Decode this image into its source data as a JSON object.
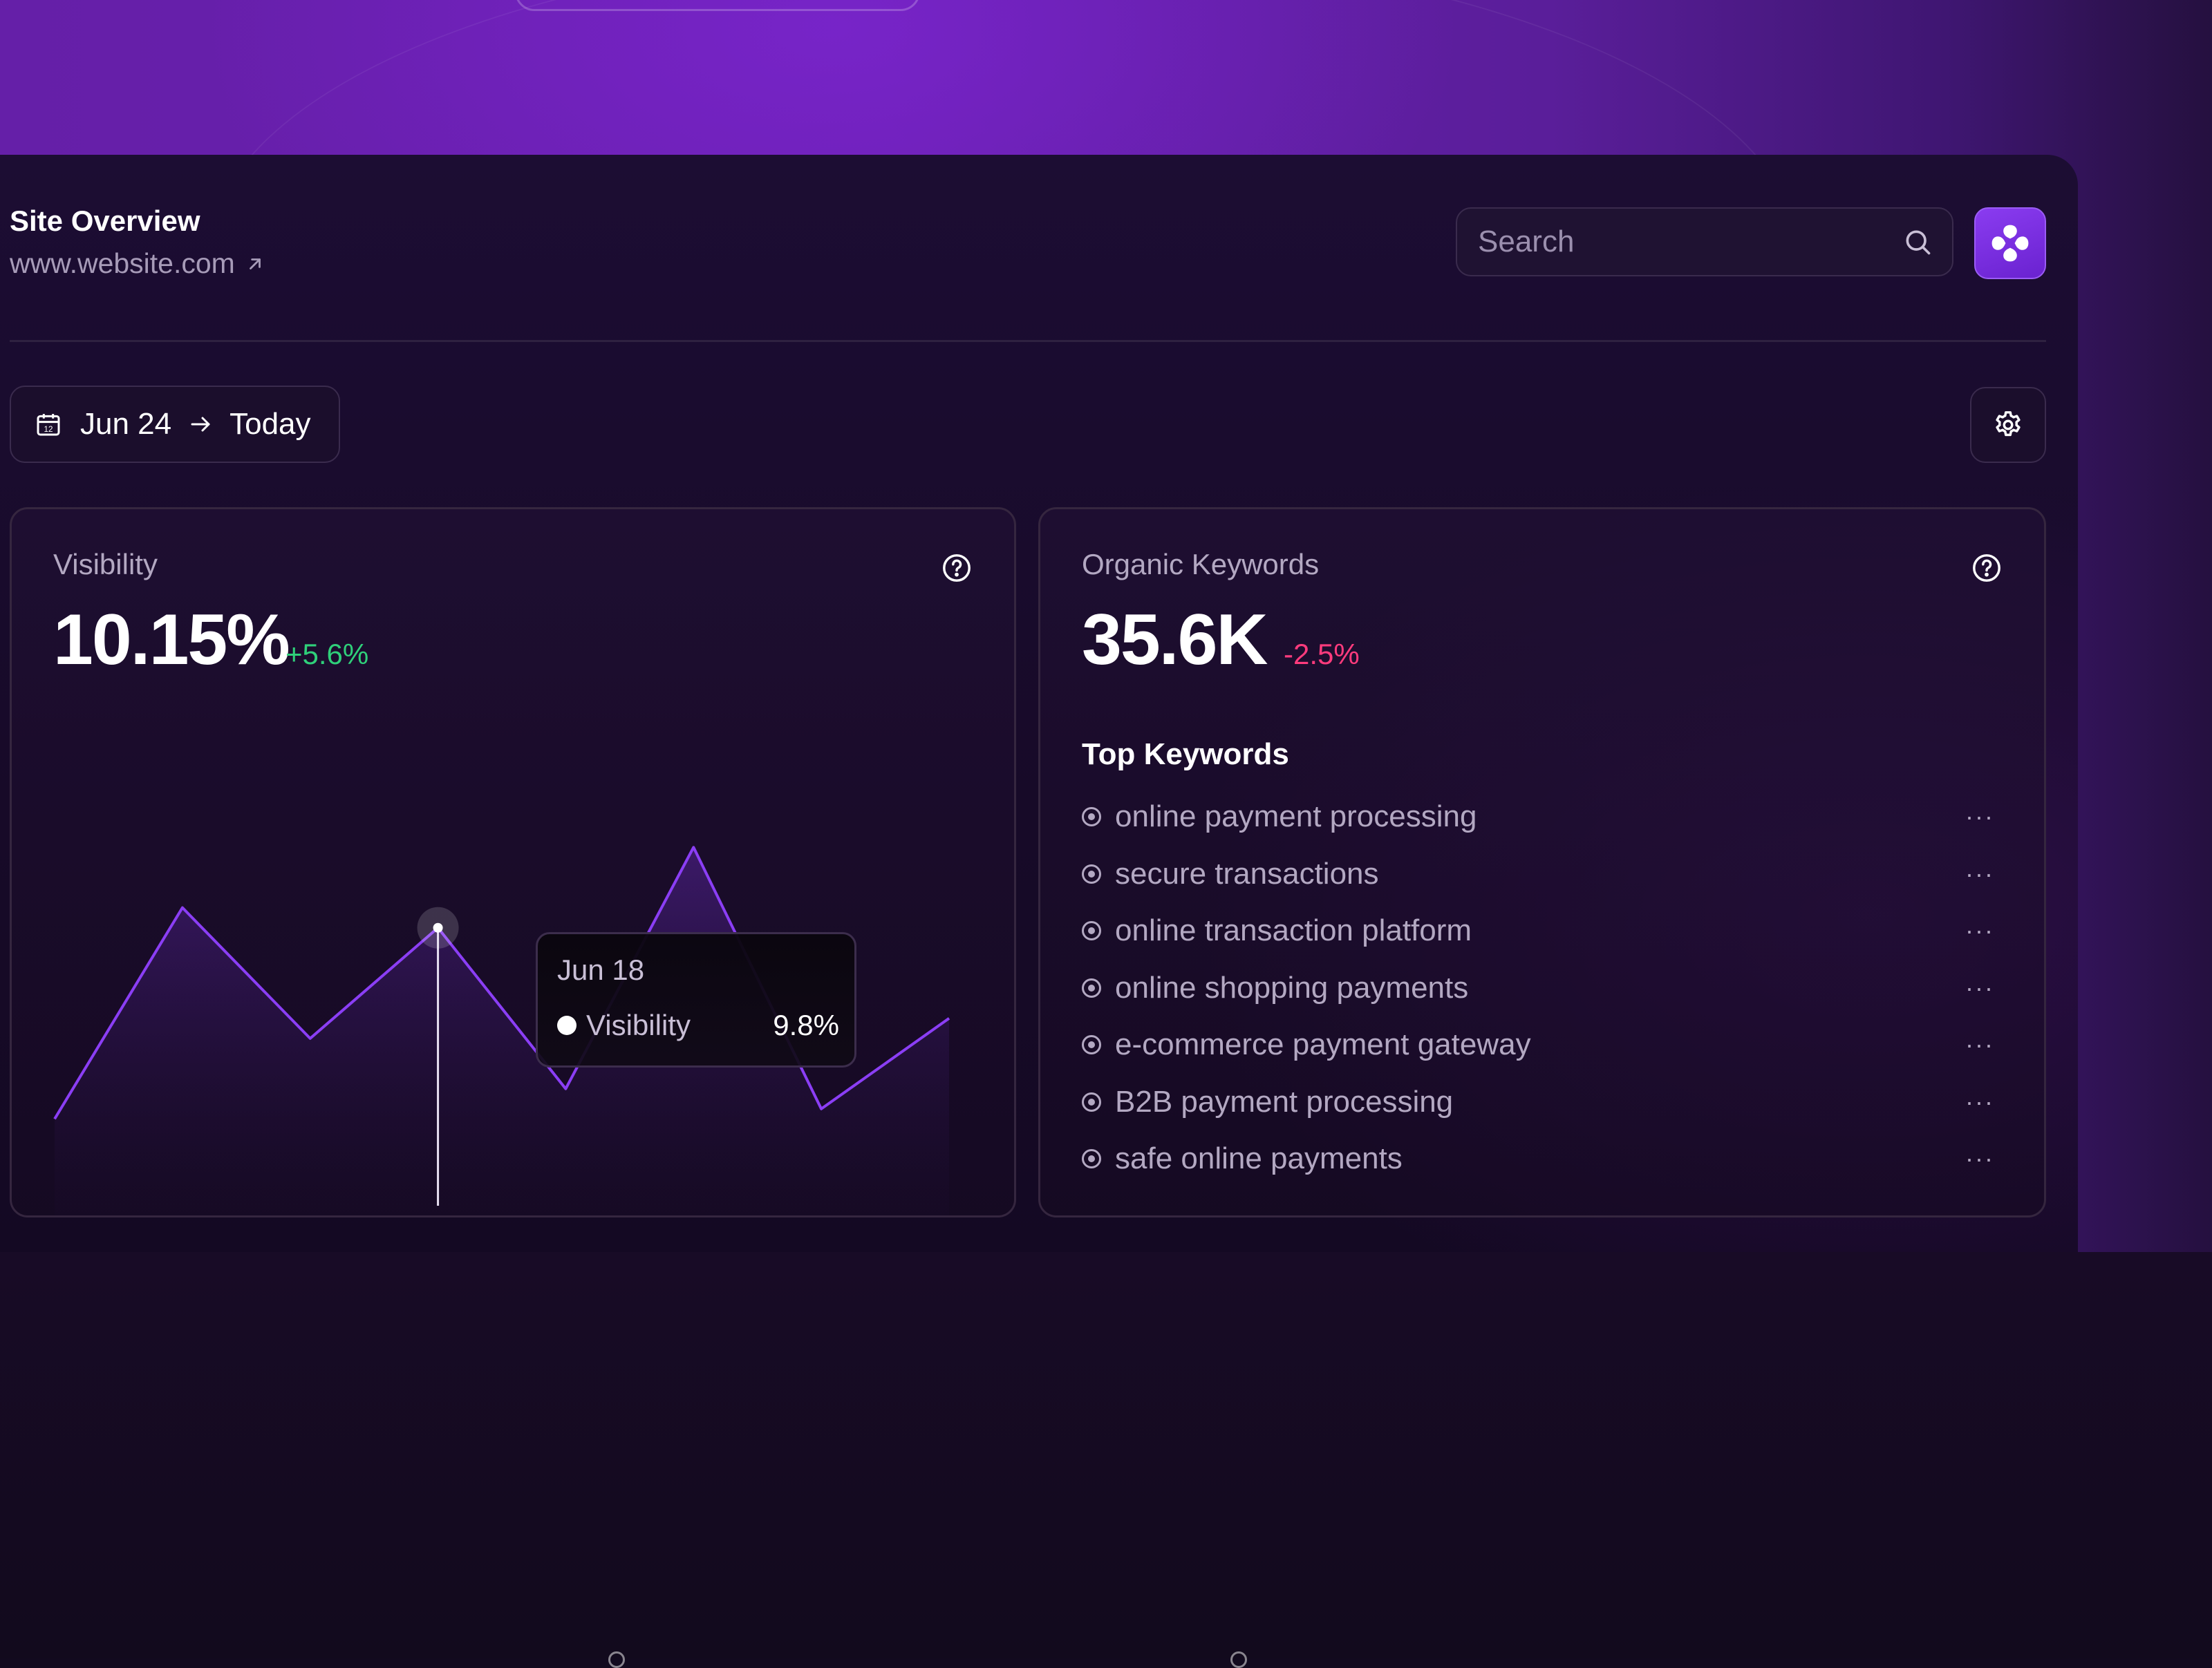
{
  "header": {
    "title": "Site Overview",
    "url": "www.website.com"
  },
  "search": {
    "placeholder": "Search"
  },
  "icons": {
    "search": "search-icon",
    "brand": "brand-logo-icon",
    "calendar": "calendar-icon",
    "settings": "gear-icon",
    "help": "help-circle-icon",
    "external": "arrow-up-right-icon",
    "more": "more-horizontal-icon"
  },
  "date_range": {
    "start": "Jun 24",
    "calendar_day": "12",
    "end": "Today"
  },
  "visibility": {
    "label": "Visibility",
    "value": "10.15%",
    "delta": "+5.6%",
    "tooltip": {
      "date": "Jun 18",
      "series": "Visibility",
      "value": "9.8%"
    },
    "chart_data": {
      "type": "area",
      "series": [
        {
          "name": "Visibility",
          "values": [
            2.0,
            6.2,
            3.6,
            5.8,
            2.6,
            7.4,
            2.2,
            4.0
          ]
        }
      ],
      "highlight_index": 3,
      "ylim": [
        0,
        10
      ]
    }
  },
  "keywords": {
    "label": "Organic Keywords",
    "value": "35.6K",
    "delta": "-2.5%",
    "list_title": "Top Keywords",
    "items": [
      "online payment processing",
      "secure transactions",
      "online transaction platform",
      "online shopping payments",
      "e-commerce payment gateway",
      "B2B payment processing",
      "safe online payments"
    ],
    "more_label": "···"
  },
  "colors": {
    "accent": "#8b3ef5",
    "positive": "#2fd07a",
    "negative": "#ff3b7d",
    "panel": "#1a0c2e",
    "hero": "#6a1fb0"
  }
}
